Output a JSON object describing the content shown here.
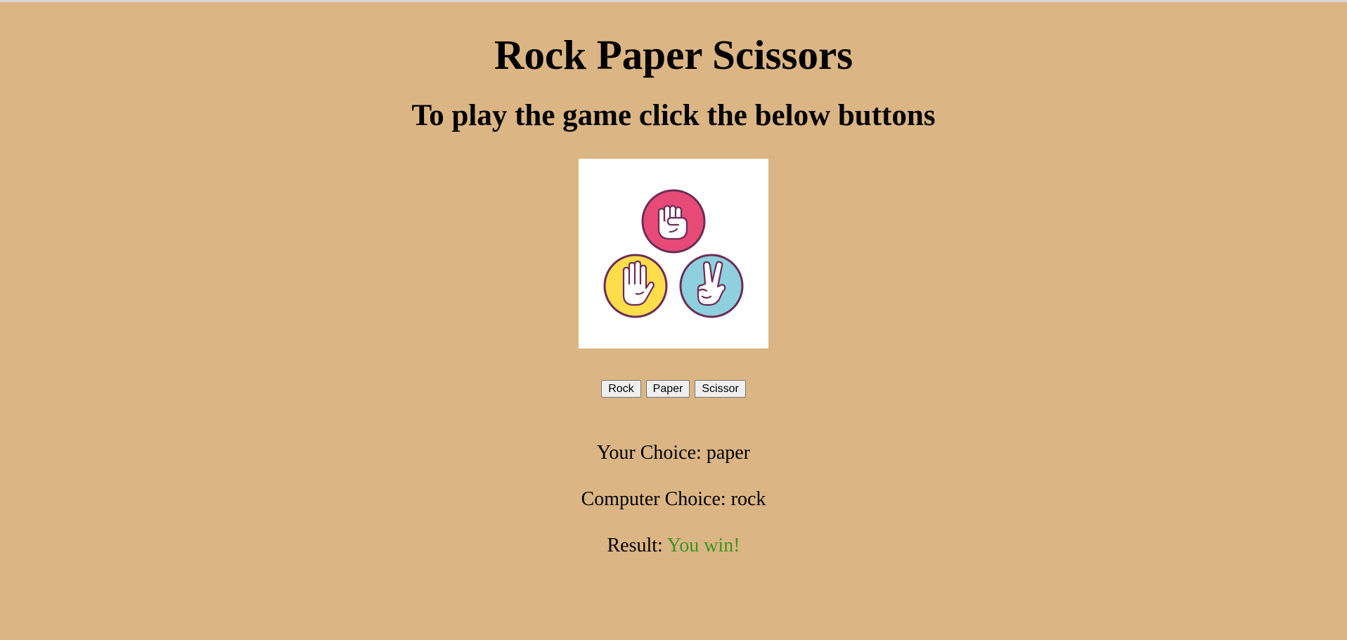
{
  "page": {
    "title": "Rock Paper Scissors",
    "subtitle": "To play the game click the below buttons"
  },
  "image": {
    "icons": [
      "rock-hand-icon",
      "paper-hand-icon",
      "scissors-hand-icon"
    ],
    "colors": {
      "rock": "#E84A77",
      "paper": "#FDDD4A",
      "scissors": "#8ED0DD",
      "outline": "#6B2C57"
    }
  },
  "buttons": {
    "rock": "Rock",
    "paper": "Paper",
    "scissor": "Scissor"
  },
  "results": {
    "your_choice_label": "Your Choice:",
    "your_choice_value": "paper",
    "computer_choice_label": "Computer Choice:",
    "computer_choice_value": "rock",
    "result_label": "Result:",
    "result_value": "You win!",
    "result_color": "#3D9321"
  },
  "colors": {
    "background": "#DBB584"
  }
}
